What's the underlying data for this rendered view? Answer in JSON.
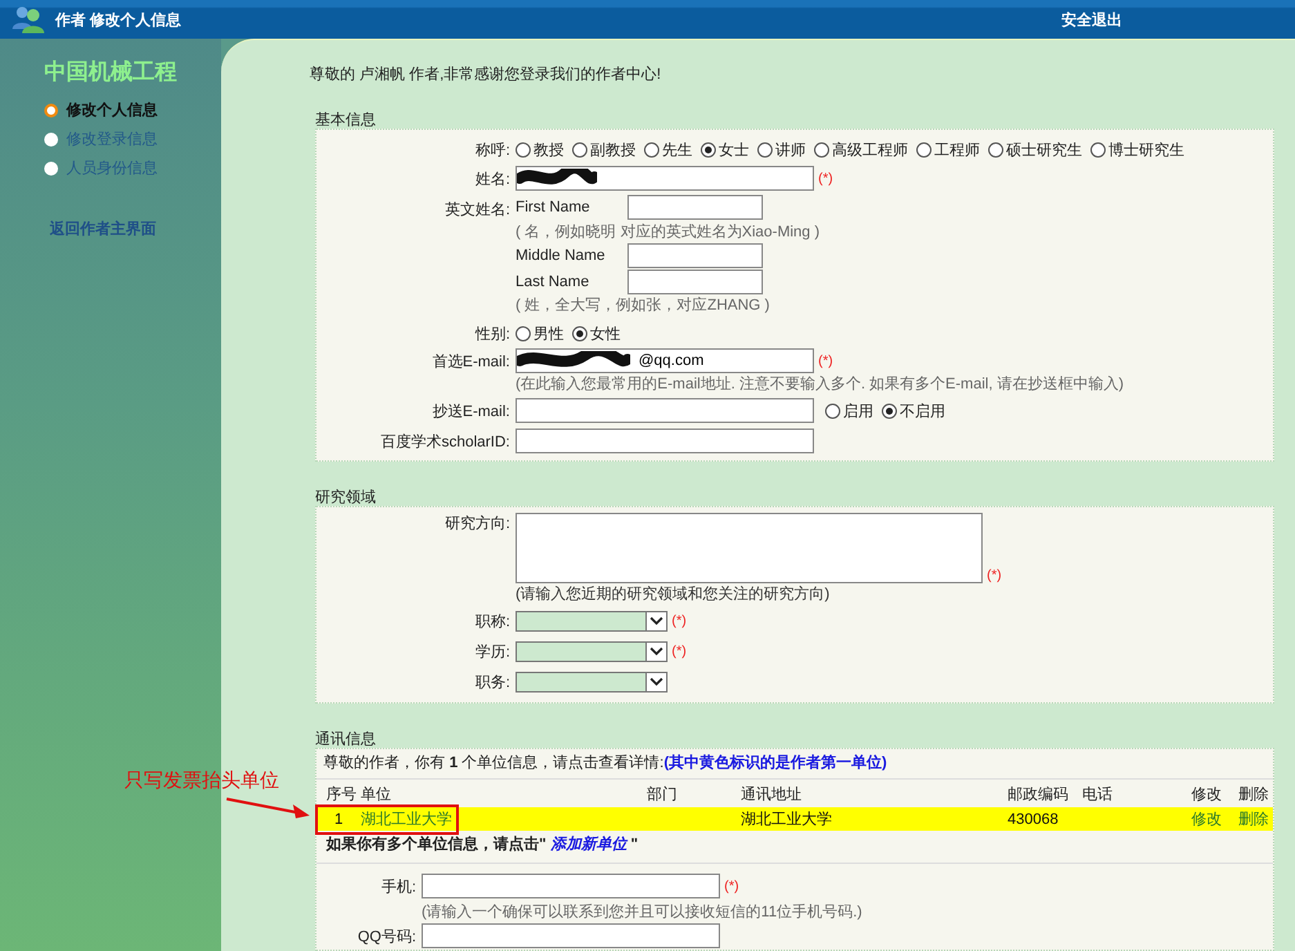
{
  "header": {
    "title": "作者 修改个人信息",
    "logout": "安全退出"
  },
  "sidebar": {
    "brand": "中国机械工程",
    "items": [
      {
        "label": "修改个人信息",
        "selected": true
      },
      {
        "label": "修改登录信息",
        "selected": false
      },
      {
        "label": "人员身份信息",
        "selected": false
      }
    ],
    "back_link": "返回作者主界面"
  },
  "welcome": "尊敬的 卢湘帆 作者,非常感谢您登录我们的作者中心!",
  "basic_info": {
    "title": "基本信息",
    "salutation": {
      "label": "称呼:",
      "options": [
        {
          "label": "教授",
          "selected": false
        },
        {
          "label": "副教授",
          "selected": false
        },
        {
          "label": "先生",
          "selected": false
        },
        {
          "label": "女士",
          "selected": true
        },
        {
          "label": "讲师",
          "selected": false
        },
        {
          "label": "高级工程师",
          "selected": false
        },
        {
          "label": "工程师",
          "selected": false
        },
        {
          "label": "硕士研究生",
          "selected": false
        },
        {
          "label": "博士研究生",
          "selected": false
        }
      ]
    },
    "name": {
      "label": "姓名:",
      "required": "(*)"
    },
    "english_name": {
      "label": "英文姓名:",
      "first": "First Name",
      "first_hint": "( 名，例如晓明 对应的英式姓名为Xiao-Ming )",
      "middle": "Middle Name",
      "last": "Last Name",
      "last_hint": "( 姓，全大写，例如张，对应ZHANG )"
    },
    "gender": {
      "label": "性别:",
      "options": [
        {
          "label": "男性",
          "selected": false
        },
        {
          "label": "女性",
          "selected": true
        }
      ]
    },
    "email": {
      "label": "首选E-mail:",
      "value": "@qq.com",
      "required": "(*)",
      "hint": "(在此输入您最常用的E-mail地址. 注意不要输入多个. 如果有多个E-mail, 请在抄送框中输入)"
    },
    "cc_email": {
      "label": "抄送E-mail:",
      "options": [
        {
          "label": "启用",
          "selected": false
        },
        {
          "label": "不启用",
          "selected": true
        }
      ]
    },
    "scholar_id": {
      "label": "百度学术scholarID:"
    }
  },
  "research": {
    "title": "研究领域",
    "direction": {
      "label": "研究方向:",
      "required": "(*)",
      "hint": "(请输入您近期的研究领域和您关注的研究方向)"
    },
    "selects": [
      {
        "label": "职称:",
        "required": "(*)"
      },
      {
        "label": "学历:",
        "required": "(*)"
      },
      {
        "label": "职务:"
      }
    ]
  },
  "contact": {
    "title": "通讯信息",
    "intro": "尊敬的作者，你有 **1** 个单位信息，请点击查看详情:",
    "intro_note": "(其中黄色标识的是作者第一单位)",
    "columns": [
      "序号",
      "单位",
      "部门",
      "通讯地址",
      "邮政编码",
      "电话",
      "修改",
      "删除"
    ],
    "rows": [
      {
        "highlighted": true,
        "number": "1",
        "unit": "湖北工业大学",
        "address": "湖北工业大学",
        "postcode": "430068",
        "edit": "修改",
        "delete": "删除"
      }
    ],
    "add_prompt": "如果你有多个单位信息，请点击\"",
    "add_link": "添加新单位",
    "add_end": "\"",
    "mobile": {
      "label": "手机:",
      "required": "(*)",
      "hint": "(请输入一个确保可以联系到您并且可以接收短信的11位手机号码.)"
    },
    "qq": {
      "label": "QQ号码:"
    }
  },
  "annotation": {
    "text": "只写发票抬头单位"
  }
}
